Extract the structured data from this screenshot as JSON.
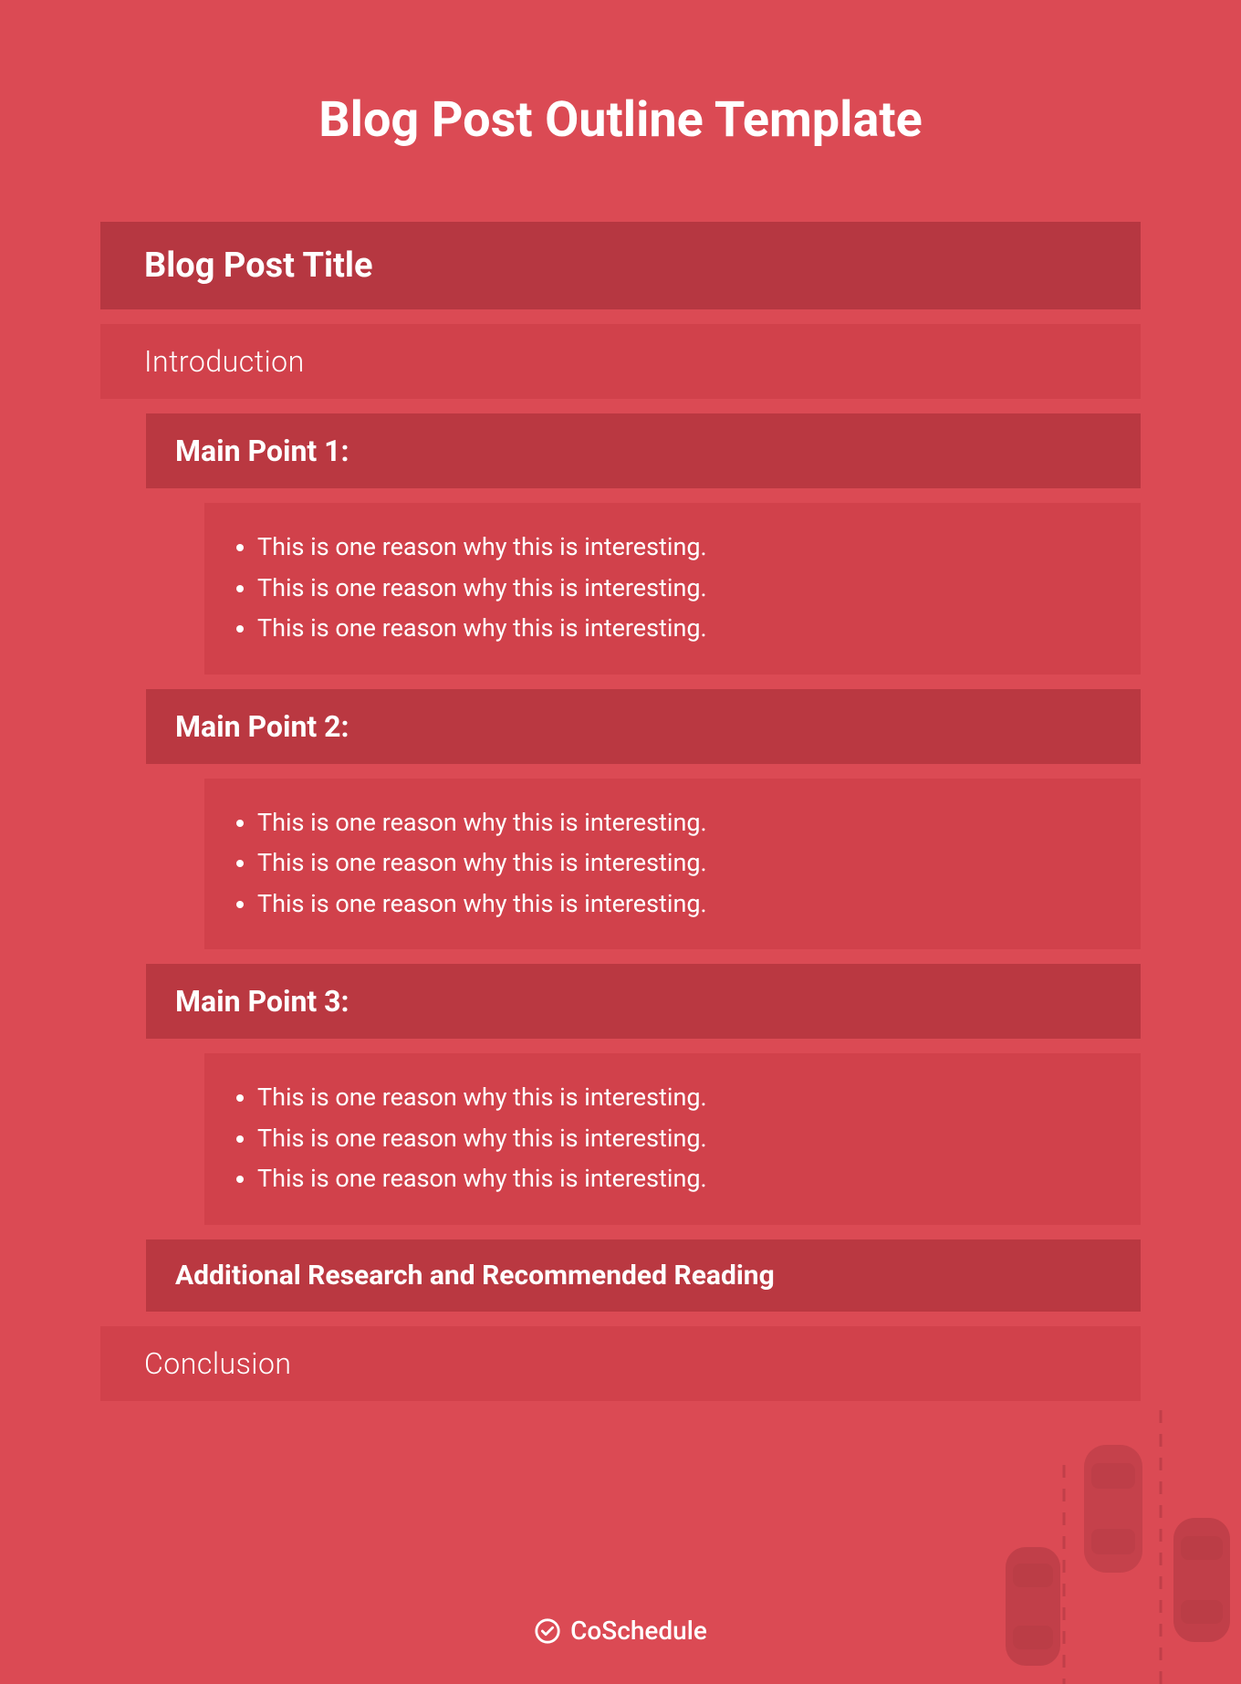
{
  "title": "Blog Post Outline Template",
  "sections": {
    "blog_title": "Blog Post Title",
    "introduction": "Introduction",
    "main_points": [
      {
        "heading": "Main Point 1:",
        "reasons": [
          "This is one reason why this is interesting.",
          "This is one reason why this is interesting.",
          "This is one reason why this is interesting."
        ]
      },
      {
        "heading": "Main Point 2:",
        "reasons": [
          "This is one reason why this is interesting.",
          "This is one reason why this is interesting.",
          "This is one reason why this is interesting."
        ]
      },
      {
        "heading": "Main Point 3:",
        "reasons": [
          "This is one reason why this is interesting.",
          "This is one reason why this is interesting.",
          "This is one reason why this is interesting."
        ]
      }
    ],
    "additional": "Additional Research and Recommended Reading",
    "conclusion": "Conclusion"
  },
  "brand": "CoSchedule",
  "colors": {
    "background": "#db4a54",
    "band_dark": "#b63741",
    "band_mid": "#ba3841",
    "band_light": "#d1414b"
  }
}
